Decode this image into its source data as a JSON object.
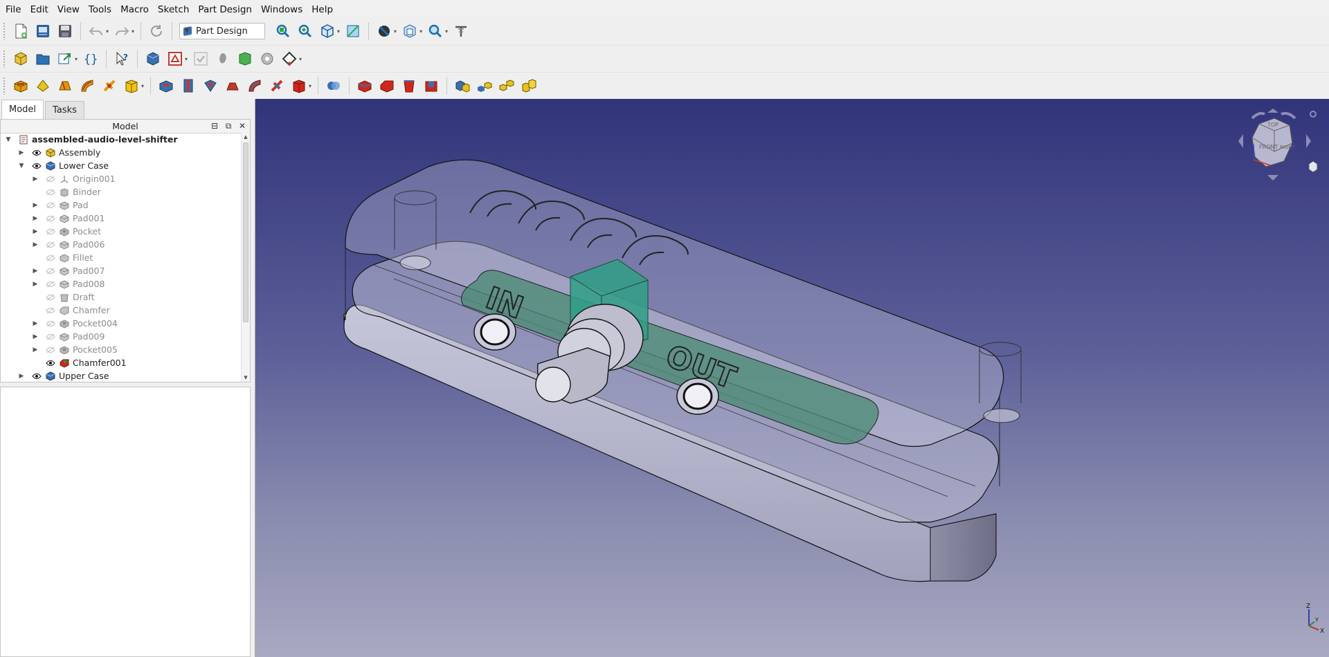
{
  "menu": [
    "File",
    "Edit",
    "View",
    "Tools",
    "Macro",
    "Sketch",
    "Part Design",
    "Windows",
    "Help"
  ],
  "toolbar": {
    "workbench": "Part Design"
  },
  "panel": {
    "tabs": [
      "Model",
      "Tasks"
    ],
    "tree_header": "Model",
    "tree": [
      {
        "label": "assembled-audio-level-shifter",
        "depth": 0,
        "expand": "open",
        "eye": false,
        "icon": "document-icon",
        "dim": false,
        "bold": true
      },
      {
        "label": "Assembly",
        "depth": 1,
        "expand": "closed",
        "eye": true,
        "icon": "assembly-icon",
        "dim": false
      },
      {
        "label": "Lower Case",
        "depth": 1,
        "expand": "open",
        "eye": true,
        "icon": "body-icon",
        "dim": false
      },
      {
        "label": "Origin001",
        "depth": 2,
        "expand": "closed",
        "eye": false,
        "icon": "origin-icon",
        "dim": true
      },
      {
        "label": "Binder",
        "depth": 2,
        "expand": "none",
        "eye": false,
        "icon": "binder-icon",
        "dim": true
      },
      {
        "label": "Pad",
        "depth": 2,
        "expand": "closed",
        "eye": false,
        "icon": "pad-icon",
        "dim": true
      },
      {
        "label": "Pad001",
        "depth": 2,
        "expand": "closed",
        "eye": false,
        "icon": "pad-icon",
        "dim": true
      },
      {
        "label": "Pocket",
        "depth": 2,
        "expand": "closed",
        "eye": false,
        "icon": "pocket-icon",
        "dim": true
      },
      {
        "label": "Pad006",
        "depth": 2,
        "expand": "closed",
        "eye": false,
        "icon": "pad-icon",
        "dim": true
      },
      {
        "label": "Fillet",
        "depth": 2,
        "expand": "none",
        "eye": false,
        "icon": "fillet-icon",
        "dim": true
      },
      {
        "label": "Pad007",
        "depth": 2,
        "expand": "closed",
        "eye": false,
        "icon": "pad-icon",
        "dim": true
      },
      {
        "label": "Pad008",
        "depth": 2,
        "expand": "closed",
        "eye": false,
        "icon": "pad-icon",
        "dim": true
      },
      {
        "label": "Draft",
        "depth": 2,
        "expand": "none",
        "eye": false,
        "icon": "draft-icon",
        "dim": true
      },
      {
        "label": "Chamfer",
        "depth": 2,
        "expand": "none",
        "eye": false,
        "icon": "chamfer-icon",
        "dim": true
      },
      {
        "label": "Pocket004",
        "depth": 2,
        "expand": "closed",
        "eye": false,
        "icon": "pocket-icon",
        "dim": true
      },
      {
        "label": "Pad009",
        "depth": 2,
        "expand": "closed",
        "eye": false,
        "icon": "pad-icon",
        "dim": true
      },
      {
        "label": "Pocket005",
        "depth": 2,
        "expand": "closed",
        "eye": false,
        "icon": "pocket-icon",
        "dim": true
      },
      {
        "label": "Chamfer001",
        "depth": 2,
        "expand": "none",
        "eye": true,
        "icon": "chamfer-tip-icon",
        "dim": false
      },
      {
        "label": "Upper Case",
        "depth": 1,
        "expand": "closed",
        "eye": true,
        "icon": "body-icon",
        "dim": false
      }
    ]
  },
  "model_text": {
    "in_label": "IN",
    "out_label": "OUT",
    "lid_label": "ᑕᑕᑕᑕ"
  },
  "navcube": {
    "top": "TOP",
    "front": "FRONT",
    "right": "RIGHT"
  },
  "axes": {
    "x": "X",
    "y": "Y",
    "z": "Z"
  },
  "colors": {
    "viewport_top": "#31347a",
    "viewport_bottom": "#a9a9c2",
    "pcb": "#4f8c77",
    "pot": "#2f9f86",
    "case": "#b8b8cf"
  }
}
